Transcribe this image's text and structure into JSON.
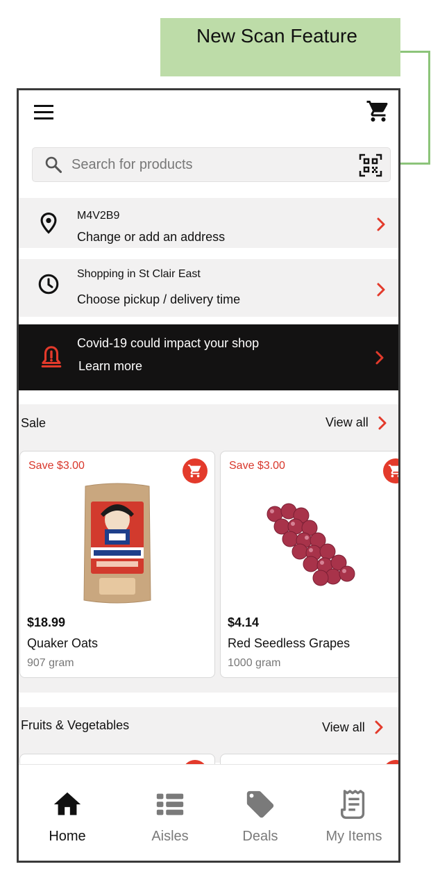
{
  "annotation": {
    "label": "New Scan Feature",
    "color": "#bddca8"
  },
  "header": {
    "menu_icon": "hamburger-menu-icon",
    "cart_icon": "cart-icon"
  },
  "search": {
    "placeholder": "Search for products",
    "scan_icon": "qr-scan-icon"
  },
  "address": {
    "postal_code": "M4V2B9",
    "action": "Change or add an address",
    "icon": "location-pin-icon"
  },
  "time_slot": {
    "store": "Shopping in St Clair East",
    "action": "Choose pickup / delivery time",
    "icon": "clock-icon"
  },
  "alert": {
    "title": "Covid-19 could impact your shop",
    "action": "Learn more",
    "icon": "alert-bell-icon",
    "bg": "#131212"
  },
  "sections": [
    {
      "title": "Sale",
      "view_all": "View all",
      "products": [
        {
          "badge": "Save $3.00",
          "price": "$18.99",
          "name": "Quaker Oats",
          "size": "907 gram"
        },
        {
          "badge": "Save $3.00",
          "price": "$4.14",
          "name": "Red Seedless Grapes",
          "size": "1000 gram"
        }
      ]
    },
    {
      "title": "Fruits & Vegetables",
      "view_all": "View all"
    }
  ],
  "bottom_nav": [
    {
      "label": "Home",
      "icon": "home-icon",
      "active": true
    },
    {
      "label": "Aisles",
      "icon": "aisles-list-icon",
      "active": false
    },
    {
      "label": "Deals",
      "icon": "tag-icon",
      "active": false
    },
    {
      "label": "My Items",
      "icon": "receipt-icon",
      "active": false
    }
  ],
  "colors": {
    "accent": "#e33a2b",
    "panel": "#f2f1f1",
    "nav_inactive": "#7a7a7a"
  }
}
